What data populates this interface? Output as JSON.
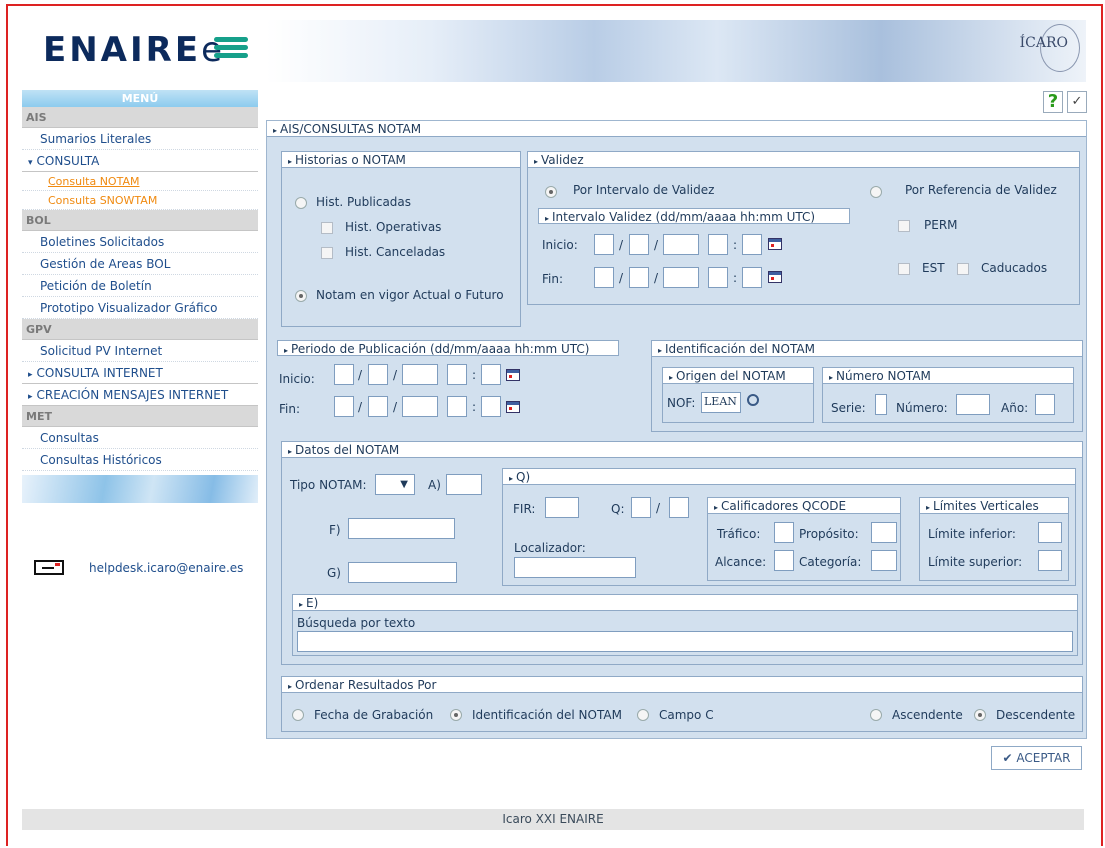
{
  "header": {
    "logo": "ENAIRE",
    "logo_tail": "e",
    "icaro": "ÍCARO"
  },
  "sidebar": {
    "menu_title": "MENÚ",
    "sections": [
      {
        "name": "AIS"
      },
      {
        "name": "BOL"
      },
      {
        "name": "GPV"
      },
      {
        "name": "MET"
      }
    ],
    "ais": [
      "Sumarios Literales",
      "CONSULTA",
      "Consulta NOTAM",
      "Consulta SNOWTAM"
    ],
    "bol": [
      "Boletines Solicitados",
      "Gestión de Areas BOL",
      "Petición de Boletín",
      "Prototipo Visualizador Gráfico"
    ],
    "gpv": [
      "Solicitud PV Internet",
      "CONSULTA INTERNET",
      "CREACIÓN MENSAJES INTERNET"
    ],
    "met": [
      "Consultas",
      "Consultas Históricos"
    ],
    "email": "helpdesk.icaro@enaire.es"
  },
  "toolbar": {
    "help": "?",
    "check": "✓"
  },
  "main": {
    "title": "AIS/CONSULTAS NOTAM",
    "historias": {
      "title": "Historias o NOTAM",
      "hist_publicadas": "Hist. Publicadas",
      "hist_operativas": "Hist. Operativas",
      "hist_canceladas": "Hist. Canceladas",
      "notam_vigor": "Notam en vigor Actual o Futuro"
    },
    "validez": {
      "title": "Validez",
      "por_intervalo": "Por Intervalo de Validez",
      "por_referencia": "Por Referencia de Validez",
      "intervalo_title": "Intervalo Validez (dd/mm/aaaa hh:mm UTC)",
      "inicio": "Inicio:",
      "fin": "Fin:",
      "perm": "PERM",
      "est": "EST",
      "caducados": "Caducados"
    },
    "periodo": {
      "title": "Periodo de Publicación (dd/mm/aaaa hh:mm UTC)",
      "inicio": "Inicio:",
      "fin": "Fin:"
    },
    "identificacion": {
      "title": "Identificación del NOTAM",
      "origen_title": "Origen del NOTAM",
      "nof_label": "NOF:",
      "nof_value": "LEAN",
      "numero_title": "Número NOTAM",
      "serie": "Serie:",
      "numero": "Número:",
      "anio": "Año:"
    },
    "datos": {
      "title": "Datos del NOTAM",
      "tipo_label": "Tipo NOTAM:",
      "a_label": "A)",
      "f_label": "F)",
      "g_label": "G)",
      "q_title": "Q)",
      "fir_label": "FIR:",
      "q_label": "Q:",
      "localizador": "Localizador:",
      "calificadores_title": "Calificadores QCODE",
      "trafico": "Tráfico:",
      "proposito": "Propósito:",
      "alcance": "Alcance:",
      "categoria": "Categoría:",
      "limites_title": "Límites Verticales",
      "limite_inferior": "Límite inferior:",
      "limite_superior": "Límite superior:",
      "e_title": "E)",
      "busqueda": "Búsqueda por texto"
    },
    "ordenar": {
      "title": "Ordenar Resultados Por",
      "fecha": "Fecha de Grabación",
      "ident": "Identificación del NOTAM",
      "campo_c": "Campo C",
      "ascendente": "Ascendente",
      "descendente": "Descendente"
    }
  },
  "accept_label": "✔ ACEPTAR",
  "footer": "Icaro XXI ENAIRE"
}
